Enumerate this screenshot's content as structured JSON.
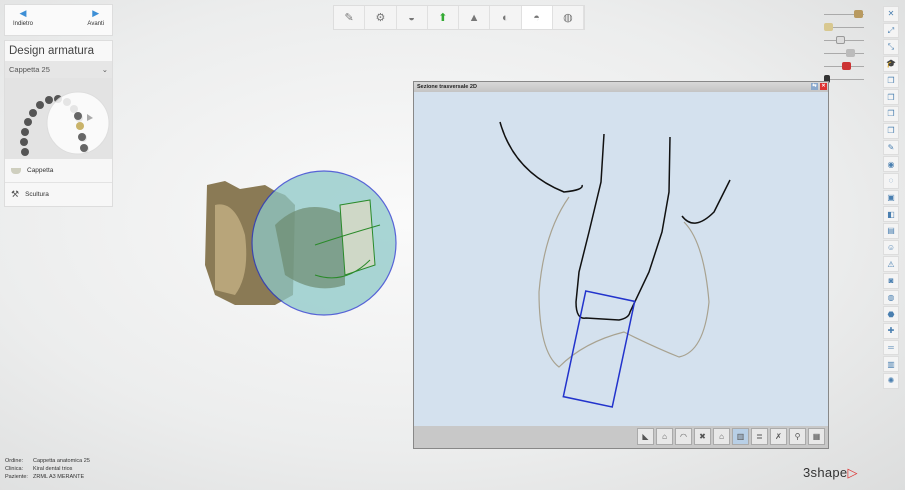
{
  "nav": {
    "back": "Indietro",
    "forward": "Avanti"
  },
  "panel": {
    "title": "Design armatura",
    "selected_tooth": "Cappetta 25",
    "items": [
      {
        "label": "Cappetta"
      },
      {
        "label": "Scultura"
      }
    ]
  },
  "info": {
    "labels": [
      "Ordine:",
      "Clinica:",
      "Paziente:"
    ],
    "values": [
      "Cappetta anatomica 25",
      "Kiral dental trios",
      "ZRML A3 MERANTE"
    ]
  },
  "window": {
    "title": "Sezione trasversale 2D"
  },
  "logo": {
    "text": "3shape",
    "mark": "▷"
  },
  "colors": {
    "accent": "#3d8fd6",
    "section_outline": "#2233cc",
    "sphere": "#8ec9c8"
  }
}
